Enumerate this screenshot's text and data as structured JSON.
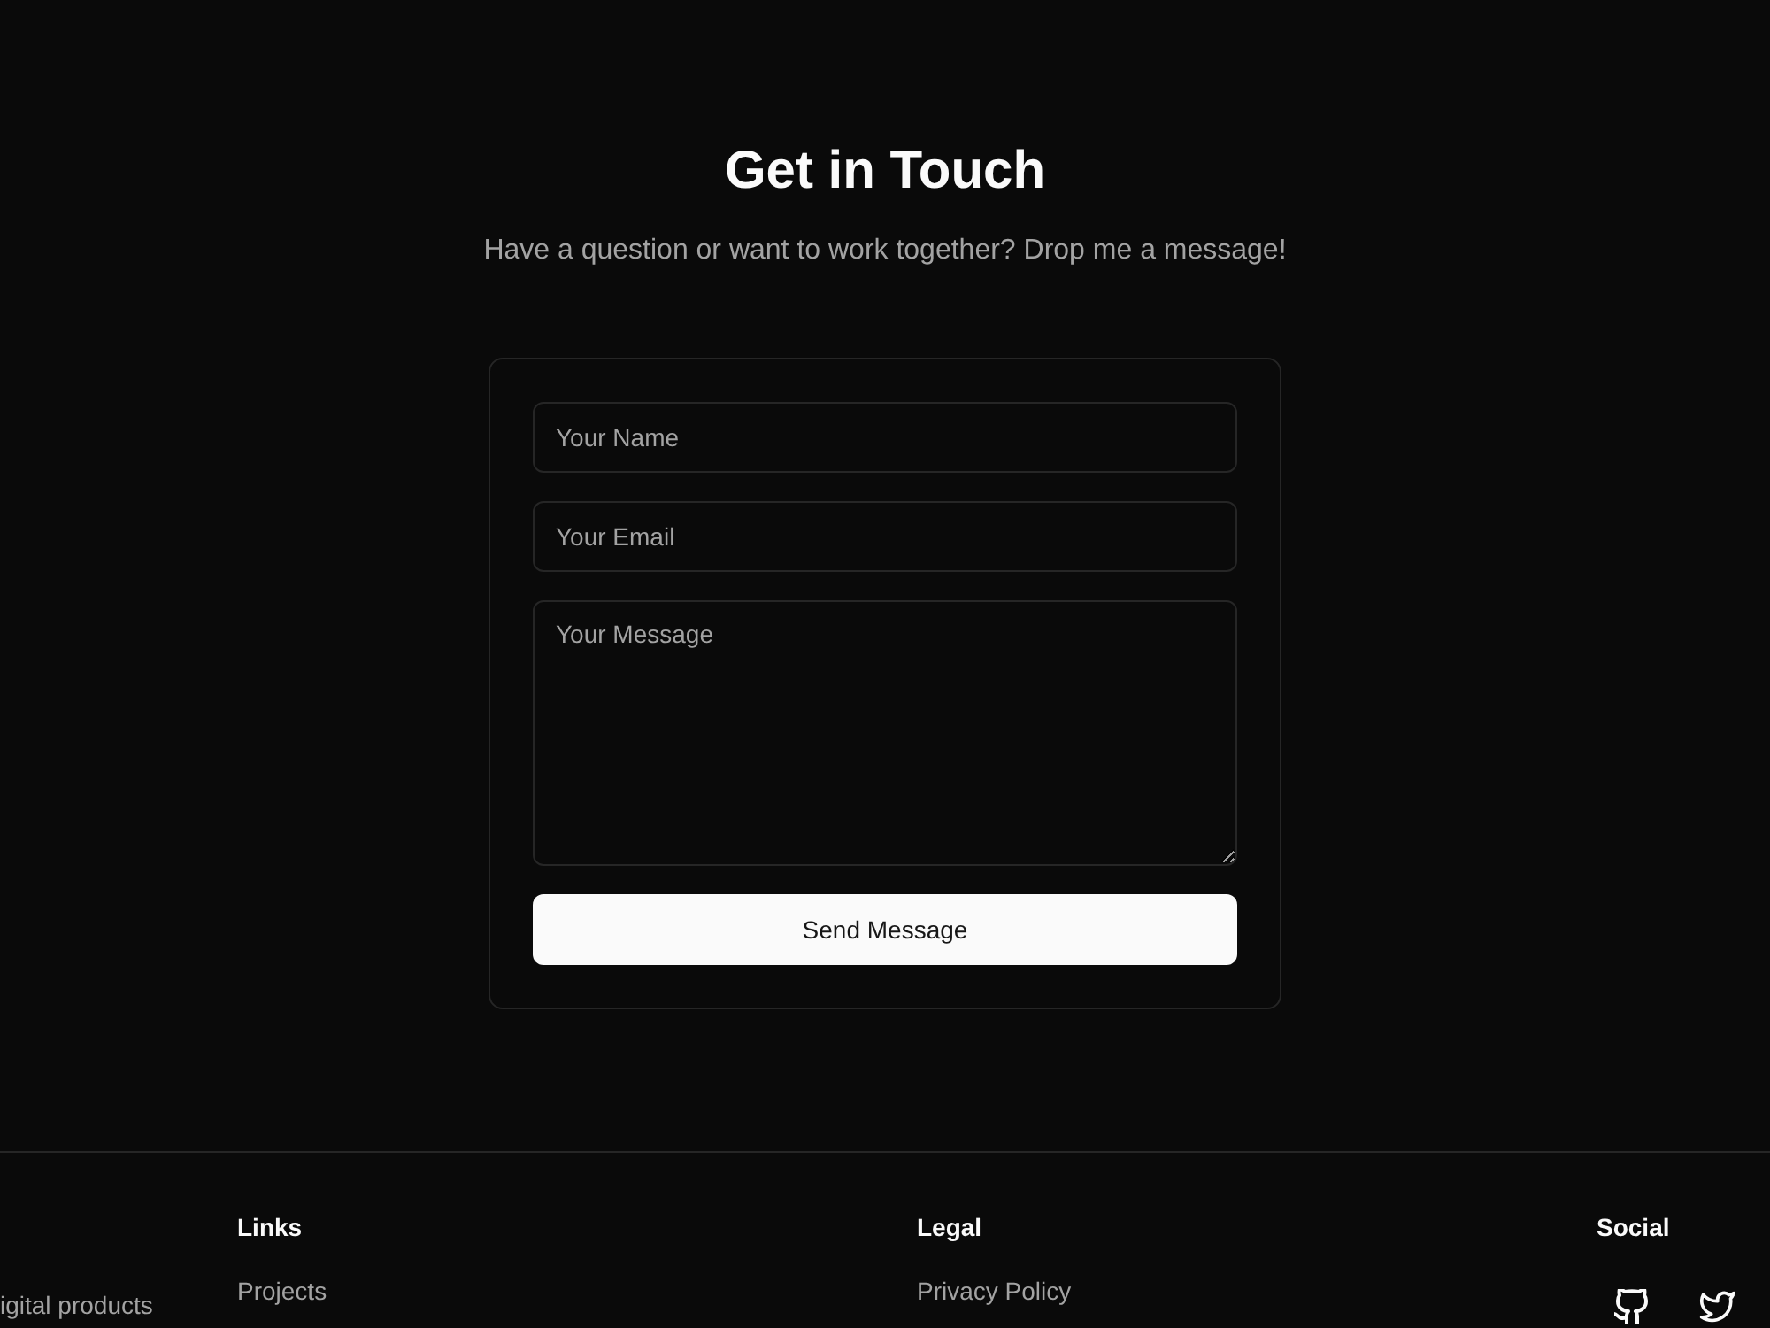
{
  "header": {
    "title": "Get in Touch",
    "subtitle": "Have a question or want to work together? Drop me a message!"
  },
  "form": {
    "fields": [
      {
        "kind": "input",
        "placeholder": "Your Name"
      },
      {
        "kind": "input",
        "placeholder": "Your Email"
      },
      {
        "kind": "textarea",
        "placeholder": "Your Message"
      }
    ],
    "submit": "Send Message"
  },
  "footer": {
    "columns": [
      {
        "kind": "text",
        "text": "igital products"
      },
      {
        "kind": "links",
        "heading": "Links",
        "links": [
          "Projects"
        ]
      },
      {
        "kind": "links",
        "heading": "Legal",
        "links": [
          "Privacy Policy"
        ]
      },
      {
        "kind": "social",
        "heading": "Social",
        "icons": [
          {
            "kind": "github"
          },
          {
            "kind": "twitter"
          }
        ]
      }
    ]
  }
}
